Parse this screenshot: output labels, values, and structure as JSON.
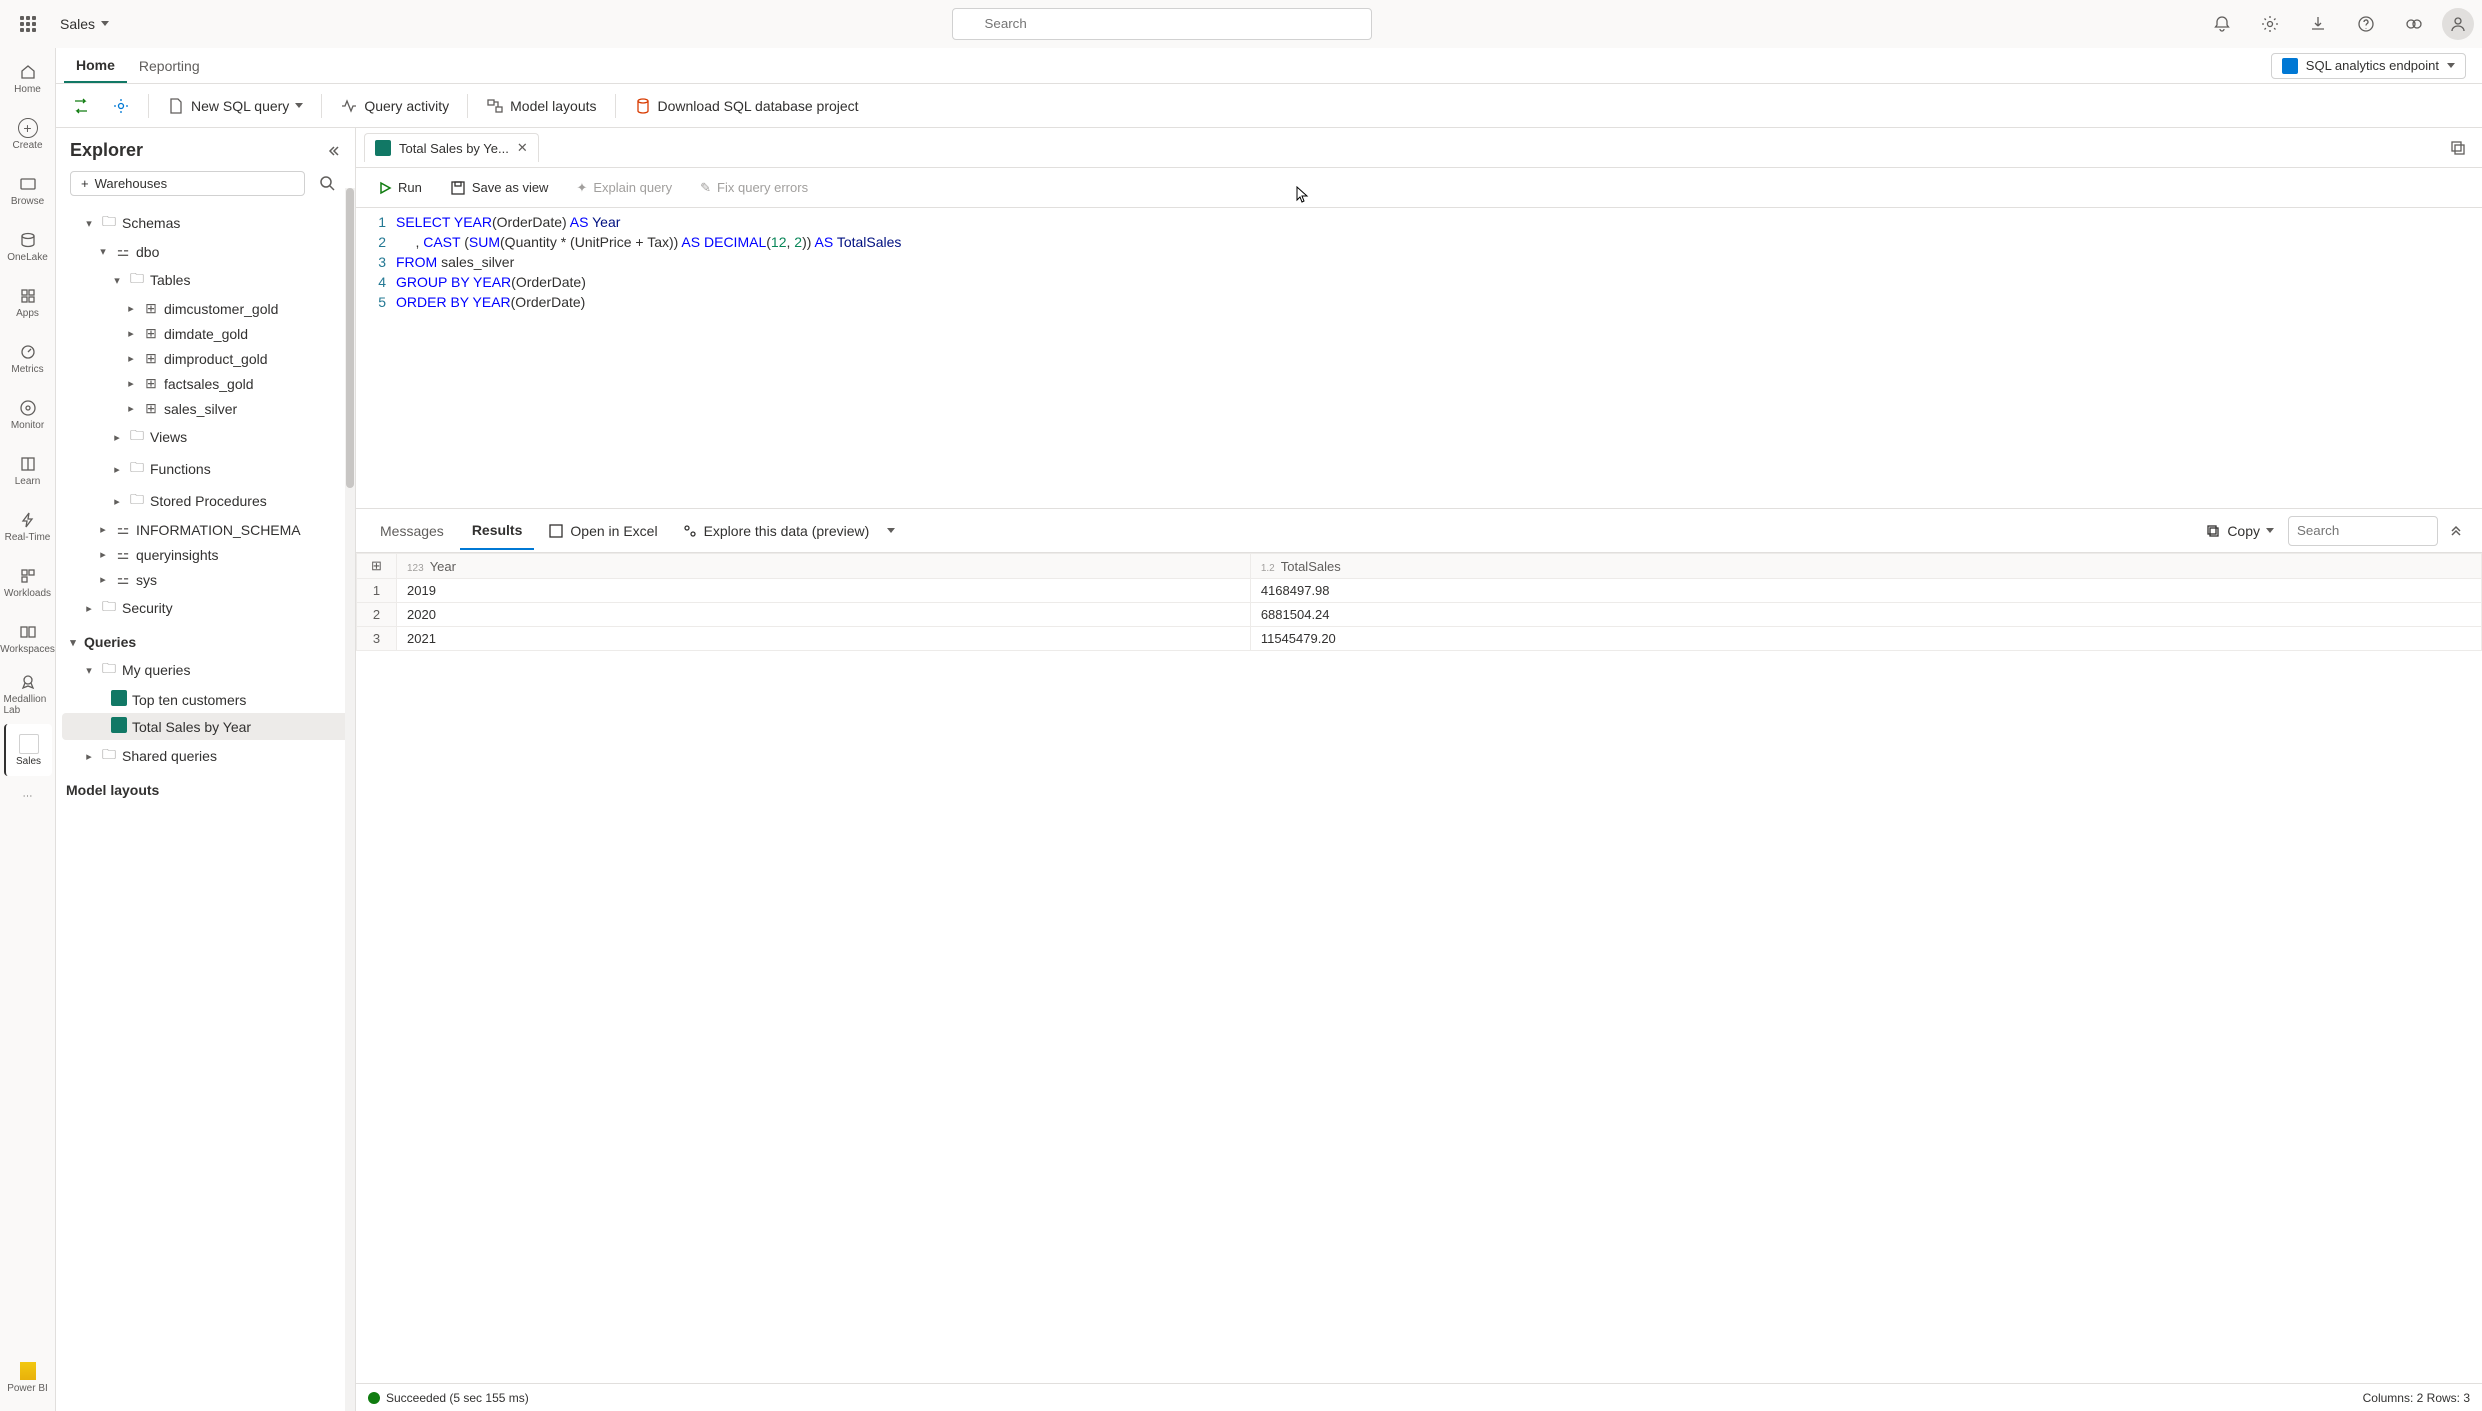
{
  "topbar": {
    "workspace": "Sales",
    "search_placeholder": "Search"
  },
  "tabs": {
    "home": "Home",
    "reporting": "Reporting"
  },
  "endpoint": {
    "label": "SQL analytics endpoint"
  },
  "toolbar": {
    "new_sql": "New SQL query",
    "query_activity": "Query activity",
    "model_layouts": "Model layouts",
    "download": "Download SQL database project"
  },
  "nav": [
    {
      "label": "Home"
    },
    {
      "label": "Create"
    },
    {
      "label": "Browse"
    },
    {
      "label": "OneLake"
    },
    {
      "label": "Apps"
    },
    {
      "label": "Metrics"
    },
    {
      "label": "Monitor"
    },
    {
      "label": "Learn"
    },
    {
      "label": "Real-Time"
    },
    {
      "label": "Workloads"
    },
    {
      "label": "Workspaces"
    },
    {
      "label": "Medallion Lab"
    },
    {
      "label": "Sales"
    },
    {
      "label": "Power BI"
    }
  ],
  "explorer": {
    "title": "Explorer",
    "warehouses": "Warehouses",
    "schemas": "Schemas",
    "dbo": "dbo",
    "tables": "Tables",
    "table_list": [
      "dimcustomer_gold",
      "dimdate_gold",
      "dimproduct_gold",
      "factsales_gold",
      "sales_silver"
    ],
    "views": "Views",
    "functions": "Functions",
    "stored_procs": "Stored Procedures",
    "info_schema": "INFORMATION_SCHEMA",
    "queryinsights": "queryinsights",
    "sys": "sys",
    "security": "Security",
    "queries": "Queries",
    "my_queries": "My queries",
    "query_list": [
      "Top ten customers",
      "Total Sales by Year"
    ],
    "shared_queries": "Shared queries",
    "model_layouts": "Model layouts"
  },
  "editor": {
    "tab_title": "Total Sales by Ye...",
    "run": "Run",
    "save_view": "Save as view",
    "explain": "Explain query",
    "fix_errors": "Fix query errors",
    "lines": [
      "1",
      "2",
      "3",
      "4",
      "5"
    ]
  },
  "sql": {
    "l1_select": "SELECT",
    "l1_year": "YEAR",
    "l1_od": "(OrderDate)",
    "l1_as": " AS ",
    "l1_yr": "Year",
    "l2_pre": "     , ",
    "l2_cast": "CAST",
    "l2_p1": " (",
    "l2_sum": "SUM",
    "l2_expr": "(Quantity * (UnitPrice + Tax))",
    "l2_as1": " AS ",
    "l2_dec": "DECIMAL",
    "l2_p2": "(",
    "l2_n1": "12",
    "l2_c": ", ",
    "l2_n2": "2",
    "l2_p3": "))",
    "l2_as2": " AS ",
    "l2_ts": "TotalSales",
    "l3_from": "FROM",
    "l3_tbl": " sales_silver",
    "l4_gb": "GROUP BY",
    "l4_year": " YEAR",
    "l4_od": "(OrderDate)",
    "l5_ob": "ORDER BY",
    "l5_year": " YEAR",
    "l5_od": "(OrderDate)"
  },
  "results": {
    "messages": "Messages",
    "results": "Results",
    "open_excel": "Open in Excel",
    "explore": "Explore this data (preview)",
    "copy": "Copy",
    "search_placeholder": "Search",
    "col_year": "Year",
    "col_total": "TotalSales",
    "type_123": "123",
    "type_12": "1.2",
    "rows": [
      {
        "n": "1",
        "year": "2019",
        "total": "4168497.98"
      },
      {
        "n": "2",
        "year": "2020",
        "total": "6881504.24"
      },
      {
        "n": "3",
        "year": "2021",
        "total": "11545479.20"
      }
    ],
    "status": "Succeeded (5 sec 155 ms)",
    "colrow": "Columns: 2 Rows: 3"
  }
}
